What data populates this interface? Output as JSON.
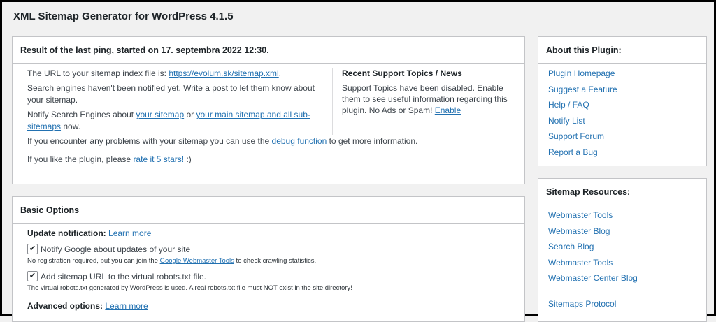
{
  "page": {
    "title": "XML Sitemap Generator for WordPress 4.1.5"
  },
  "ping": {
    "heading": "Result of the last ping, started on 17. septembra 2022 12:30.",
    "url_text": "The URL to your sitemap index file is: ",
    "url_link": "https://evolum.sk/sitemap.xml",
    "url_end": ".",
    "not_notified": "Search engines haven't been notified yet. Write a post to let them know about your sitemap.",
    "notify_prefix": "Notify Search Engines about ",
    "notify_link1": "your sitemap",
    "notify_or": " or ",
    "notify_link2": "your main sitemap and all sub-sitemaps",
    "notify_suffix": " now.",
    "problems_prefix": "If you encounter any problems with your sitemap you can use the ",
    "problems_link": "debug function",
    "problems_suffix": " to get more information.",
    "rate_prefix": "If you like the plugin, please ",
    "rate_link": "rate it 5 stars!",
    "rate_suffix": " :)"
  },
  "support": {
    "heading": "Recent Support Topics / News",
    "text": "Support Topics have been disabled. Enable them to see useful information regarding this plugin. No Ads or Spam! ",
    "enable_link": "Enable"
  },
  "basic": {
    "heading": "Basic Options",
    "update_label": "Update notification:",
    "update_link": "Learn more",
    "notify_google_label": "Notify Google about updates of your site",
    "notify_google_checked": true,
    "notify_note_prefix": "No registration required, but you can join the ",
    "notify_note_link": "Google Webmaster Tools",
    "notify_note_suffix": " to check crawling statistics.",
    "robots_label": "Add sitemap URL to the virtual robots.txt file.",
    "robots_checked": true,
    "robots_note": "The virtual robots.txt generated by WordPress is used. A real robots.txt file must NOT exist in the site directory!",
    "advanced_label": "Advanced options:",
    "advanced_link": "Learn more"
  },
  "about": {
    "heading": "About this Plugin:",
    "links": [
      "Plugin Homepage",
      "Suggest a Feature",
      "Help / FAQ",
      "Notify List",
      "Support Forum",
      "Report a Bug"
    ]
  },
  "resources": {
    "heading": "Sitemap Resources:",
    "links": [
      "Webmaster Tools",
      "Webmaster Blog",
      "Search Blog",
      "Webmaster Tools",
      "Webmaster Center Blog",
      "Sitemaps Protocol"
    ]
  },
  "icons": {
    "checkbox_checked": "checkmark-icon"
  }
}
